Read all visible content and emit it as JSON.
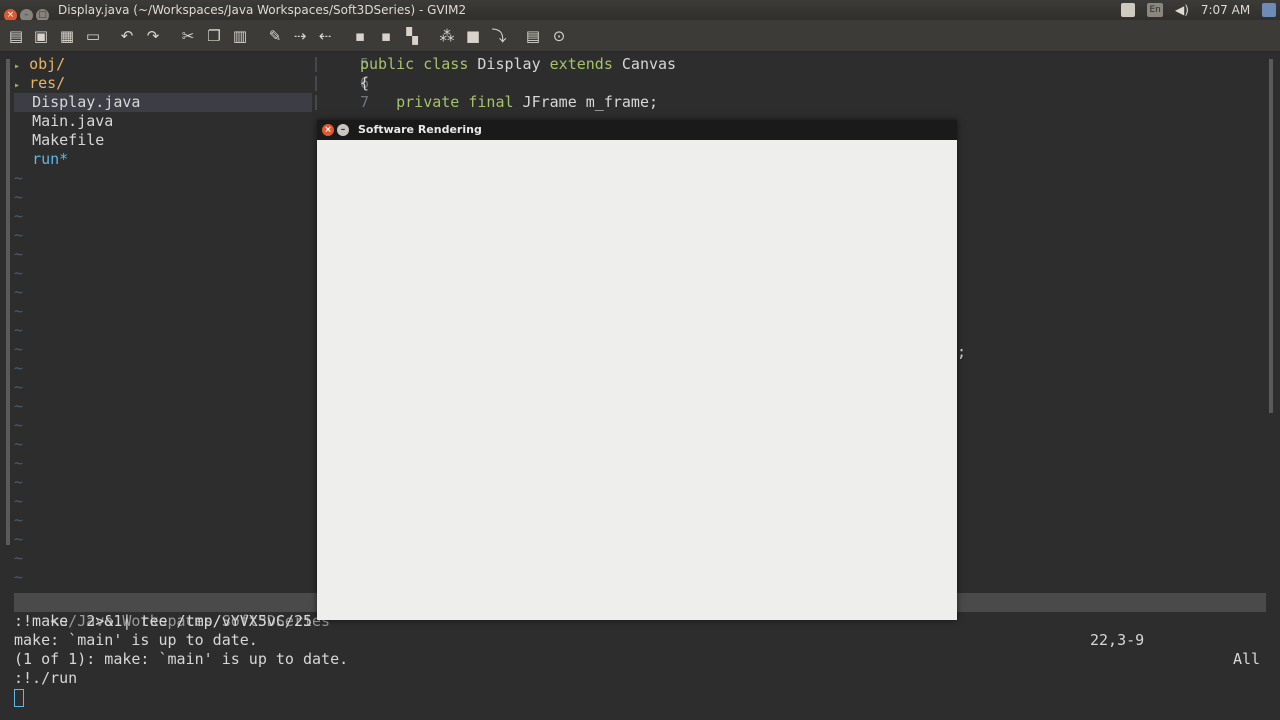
{
  "window": {
    "title": "Display.java (~/Workspaces/Java Workspaces/Soft3DSeries) - GVIM2"
  },
  "tray": {
    "lang": "En",
    "time": "7:07 AM"
  },
  "toolbar": {
    "icons": [
      "open-icon",
      "save-icon",
      "save-all-icon",
      "print-icon",
      "undo-icon",
      "redo-icon",
      "cut-icon",
      "copy-icon",
      "paste-icon",
      "find-replace-icon",
      "find-next-icon",
      "find-prev-icon",
      "load-session-icon",
      "save-session-icon",
      "run-script-icon",
      "make-icon",
      "build-tags-icon",
      "jump-tag-icon",
      "help-icon",
      "find-help-icon"
    ]
  },
  "tree": {
    "items": [
      {
        "label": "obj/",
        "type": "dir"
      },
      {
        "label": "res/",
        "type": "dir"
      },
      {
        "label": "Display.java",
        "type": "file",
        "selected": true
      },
      {
        "label": "Main.java",
        "type": "file"
      },
      {
        "label": "Makefile",
        "type": "file"
      },
      {
        "label": "run*",
        "type": "exec"
      }
    ],
    "empty_marker": "~"
  },
  "code": {
    "lines": [
      {
        "num": "5",
        "parts": [
          {
            "t": "public class",
            "k": true
          },
          {
            "t": " Display ",
            "k": false
          },
          {
            "t": "extends",
            "k": true
          },
          {
            "t": " Canvas",
            "k": false
          }
        ]
      },
      {
        "num": "6",
        "parts": [
          {
            "t": "{",
            "k": false
          }
        ]
      },
      {
        "num": "7",
        "parts": [
          {
            "t": "    private final",
            "k": true
          },
          {
            "t": " JFrame m_frame;",
            "k": false
          }
        ]
      }
    ],
    "hidden_fragment": ";"
  },
  "statusline": {
    "path": "<s/Java Workspaces/Soft3DSeries",
    "position": "22,3-9",
    "percent": "All"
  },
  "command_output": [
    ":!make  2>&1| tee /tmp/vYVX5vC/25",
    "make: `main' is up to date.",
    "(1 of 1): make: `main' is up to date.",
    ":!./run"
  ],
  "sw_window": {
    "title": "Software Rendering"
  },
  "colors": {
    "background": "#2d2d2d",
    "keyword": "#a6c26b",
    "directory": "#e5b567",
    "executable": "#5db7e8",
    "canvas": "#eeeeec"
  }
}
